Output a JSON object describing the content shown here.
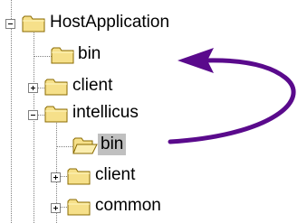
{
  "tree": {
    "nodes": [
      {
        "label": "HostApplication",
        "state": "expanded"
      },
      {
        "label": "bin",
        "state": "leaf"
      },
      {
        "label": "client",
        "state": "collapsed"
      },
      {
        "label": "intellicus",
        "state": "expanded"
      },
      {
        "label": "bin",
        "state": "leaf-selected"
      },
      {
        "label": "client",
        "state": "collapsed"
      },
      {
        "label": "common",
        "state": "collapsed"
      }
    ]
  },
  "annotation": {
    "arrow_color": "#5a0a8c",
    "arrow_meaning": "move selected bin folder up to HostApplication/bin"
  },
  "colors": {
    "folder_fill": "#f6e08a",
    "folder_outline": "#8a6a00",
    "selection_bg": "#c0c0c0"
  }
}
